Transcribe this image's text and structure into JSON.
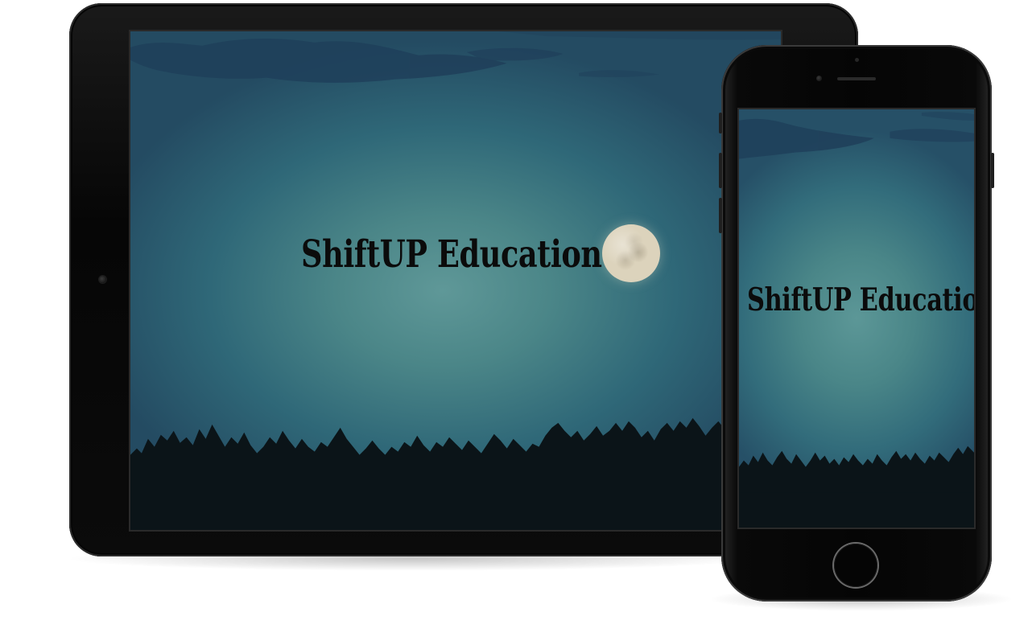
{
  "tablet": {
    "screen_title": "ShiftUP Education"
  },
  "phone": {
    "screen_title": "ShiftUP Education"
  },
  "icons": {
    "moon": "moon-icon",
    "home_button": "home-button-icon",
    "camera": "camera-icon"
  },
  "colors": {
    "sky_light": "#5f9898",
    "sky_dark": "#244b62",
    "device_body": "#060606",
    "moon": "#dcd3bc",
    "title": "#0b0b0b"
  }
}
